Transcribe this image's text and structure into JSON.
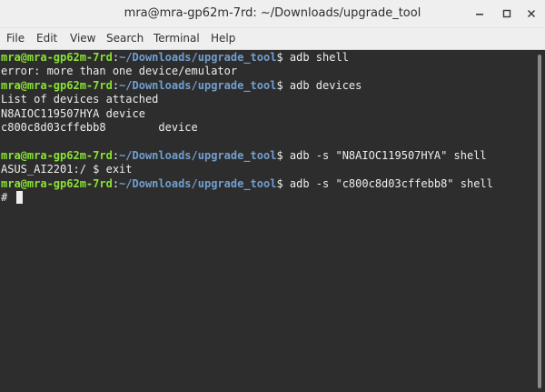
{
  "window": {
    "title": "mra@mra-gp62m-7rd: ~/Downloads/upgrade_tool",
    "controls": {
      "minimize": "minimize-icon",
      "maximize": "maximize-icon",
      "close": "close-icon"
    }
  },
  "menu": {
    "file": "File",
    "edit": "Edit",
    "view": "View",
    "search": "Search",
    "terminal": "Terminal",
    "help": "Help"
  },
  "colors": {
    "prompt_user": "#8ae234",
    "prompt_path": "#729fcf",
    "text": "#eeeeec",
    "background": "#2d2d2d"
  },
  "prompt": {
    "user_host": "mra@mra-gp62m-7rd",
    "sep": ":",
    "path": "~/Downloads/upgrade_tool",
    "dollar": "$"
  },
  "terminal": {
    "lines": [
      {
        "type": "prompt",
        "cmd": " adb shell"
      },
      {
        "type": "output",
        "text": "error: more than one device/emulator"
      },
      {
        "type": "prompt",
        "cmd": " adb devices"
      },
      {
        "type": "output",
        "text": "List of devices attached"
      },
      {
        "type": "output",
        "text": "N8AIOC119507HYA device"
      },
      {
        "type": "output",
        "text": "c800c8d03cffebb8        device"
      },
      {
        "type": "output",
        "text": ""
      },
      {
        "type": "prompt",
        "cmd": " adb -s \"N8AIOC119507HYA\" shell"
      },
      {
        "type": "output",
        "text": "ASUS_AI2201:/ $ exit"
      },
      {
        "type": "prompt",
        "cmd": " adb -s \"c800c8d03cffebb8\" shell"
      },
      {
        "type": "output",
        "text": "# "
      }
    ]
  }
}
